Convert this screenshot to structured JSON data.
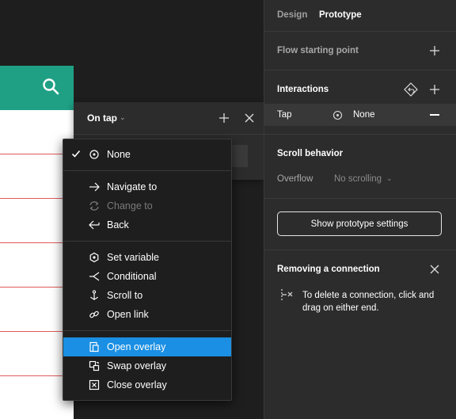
{
  "canvas": {
    "frame_header_color": "#1fa085",
    "search_icon": "search-icon"
  },
  "popup": {
    "title": "On tap",
    "caret": "⌄",
    "add_icon": "plus-icon",
    "close_icon": "close-icon"
  },
  "menu": {
    "items": [
      {
        "label": "None",
        "icon": "circle-dot-icon",
        "checked": true
      },
      {
        "label": "Navigate to",
        "icon": "arrow-right-icon"
      },
      {
        "label": "Change to",
        "icon": "swap-icon",
        "disabled": true
      },
      {
        "label": "Back",
        "icon": "arrow-left-icon"
      },
      {
        "label": "Set variable",
        "icon": "hexagon-icon"
      },
      {
        "label": "Conditional",
        "icon": "branch-icon"
      },
      {
        "label": "Scroll to",
        "icon": "anchor-icon"
      },
      {
        "label": "Open link",
        "icon": "link-icon"
      },
      {
        "label": "Open overlay",
        "icon": "overlay-icon",
        "selected": true
      },
      {
        "label": "Swap overlay",
        "icon": "swap-overlay-icon"
      },
      {
        "label": "Close overlay",
        "icon": "close-overlay-icon"
      }
    ],
    "selected_color": "#1a8fe3"
  },
  "panel": {
    "tabs": {
      "design": "Design",
      "prototype": "Prototype"
    },
    "flow_title": "Flow starting point",
    "interactions_title": "Interactions",
    "tap": {
      "trigger": "Tap",
      "action": "None"
    },
    "scroll_title": "Scroll behavior",
    "overflow_label": "Overflow",
    "overflow_value": "No scrolling",
    "overflow_caret": "⌄",
    "settings_button": "Show prototype settings",
    "remove_title": "Removing a connection",
    "remove_text": "To delete a connection, click and drag on either end."
  }
}
